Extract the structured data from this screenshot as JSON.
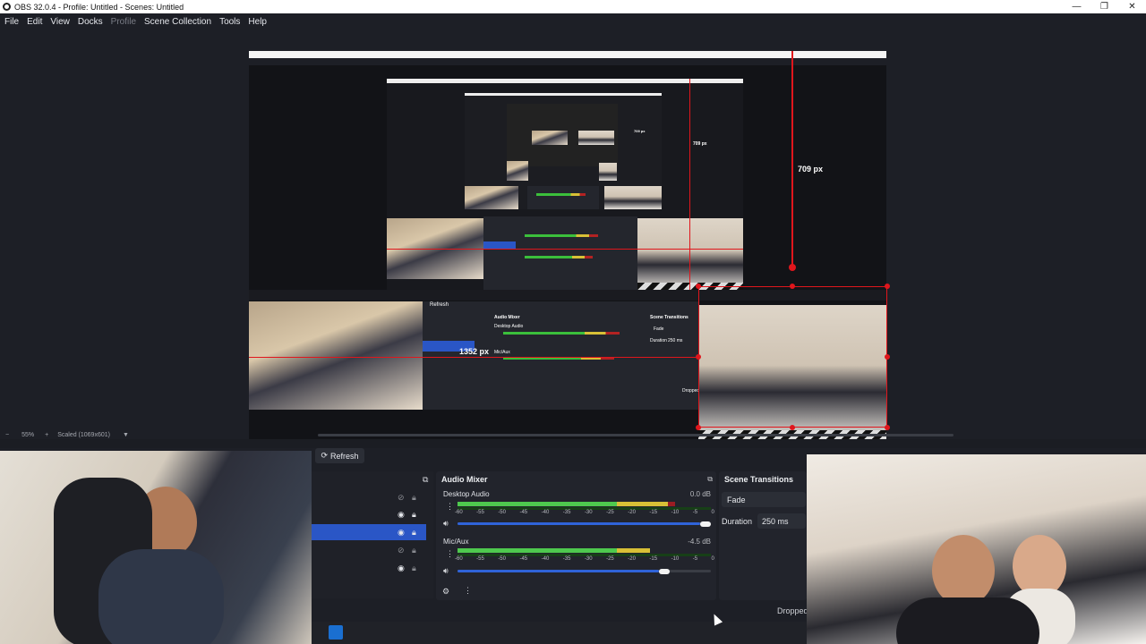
{
  "window": {
    "title": "OBS 32.0.4 - Profile: Untitled - Scenes: Untitled",
    "controls": {
      "minimize": "—",
      "maximize": "❐",
      "close": "✕"
    }
  },
  "menu": {
    "items": [
      {
        "label": "File",
        "disabled": false
      },
      {
        "label": "Edit",
        "disabled": false
      },
      {
        "label": "View",
        "disabled": false
      },
      {
        "label": "Docks",
        "disabled": false
      },
      {
        "label": "Profile",
        "disabled": true
      },
      {
        "label": "Scene Collection",
        "disabled": false
      },
      {
        "label": "Tools",
        "disabled": false
      },
      {
        "label": "Help",
        "disabled": false
      }
    ]
  },
  "preview": {
    "measure_vertical": "709 px",
    "measure_horizontal": "1352 px",
    "nested_measure_vertical": "709 px",
    "nested_mini_measure": "709 px",
    "nested_refresh": "Refresh",
    "nested_audio_mixer": "Audio Mixer",
    "nested_scene_transitions": "Scene Transitions",
    "nested_desktop_audio": "Desktop Audio",
    "nested_mic_aux": "Mic/Aux",
    "nested_fade": "Fade",
    "nested_duration": "Duration",
    "nested_duration_value": "250 ms",
    "nested_dropped": "Dropped",
    "zoom": "55%",
    "scale": "Scaled (1069x601)"
  },
  "dock": {
    "refresh_label": "Refresh",
    "sources": {
      "rows": [
        {
          "visible": false,
          "locked": true,
          "selected": false
        },
        {
          "visible": true,
          "locked": true,
          "selected": false
        },
        {
          "visible": true,
          "locked": true,
          "selected": true
        },
        {
          "visible": false,
          "locked": true,
          "selected": false
        },
        {
          "visible": true,
          "locked": true,
          "selected": false
        }
      ]
    },
    "audio_mixer": {
      "title": "Audio Mixer",
      "ticks": [
        "-60",
        "-55",
        "-50",
        "-45",
        "-40",
        "-35",
        "-30",
        "-25",
        "-20",
        "-15",
        "-10",
        "-5",
        "0"
      ],
      "channels": [
        {
          "name": "Desktop Audio",
          "db": "0.0 dB",
          "level": 0.86,
          "volume": 1.0
        },
        {
          "name": "Mic/Aux",
          "db": "-4.5 dB",
          "level": 0.76,
          "volume": 0.83
        }
      ]
    },
    "scene_transitions": {
      "title": "Scene Transitions",
      "transition": "Fade",
      "duration_label": "Duration",
      "duration_value": "250 ms"
    },
    "status": {
      "dropped": "Dropped"
    }
  },
  "colors": {
    "accent": "#2a56c6",
    "measure_red": "#e0161c",
    "meter_green": "#4ec94e",
    "meter_yellow": "#d8c036",
    "meter_red": "#9c1c23"
  }
}
